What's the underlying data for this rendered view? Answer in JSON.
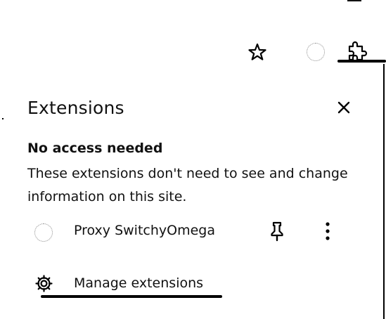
{
  "toolbar": {
    "icons": [
      "star-icon",
      "profile-icon",
      "puzzle-icon"
    ]
  },
  "panel": {
    "title": "Extensions",
    "close_icon": "close-icon",
    "section_title": "No access needed",
    "section_description": "These extensions don't need to see and change information on this site."
  },
  "extensions": [
    {
      "name": "Proxy SwitchyOmega",
      "pinned": false
    }
  ],
  "manage": {
    "label": "Manage extensions",
    "icon": "gear-icon"
  },
  "colors": {
    "text": "#111111",
    "background": "#ffffff",
    "placeholder_icon_border": "#888888"
  }
}
